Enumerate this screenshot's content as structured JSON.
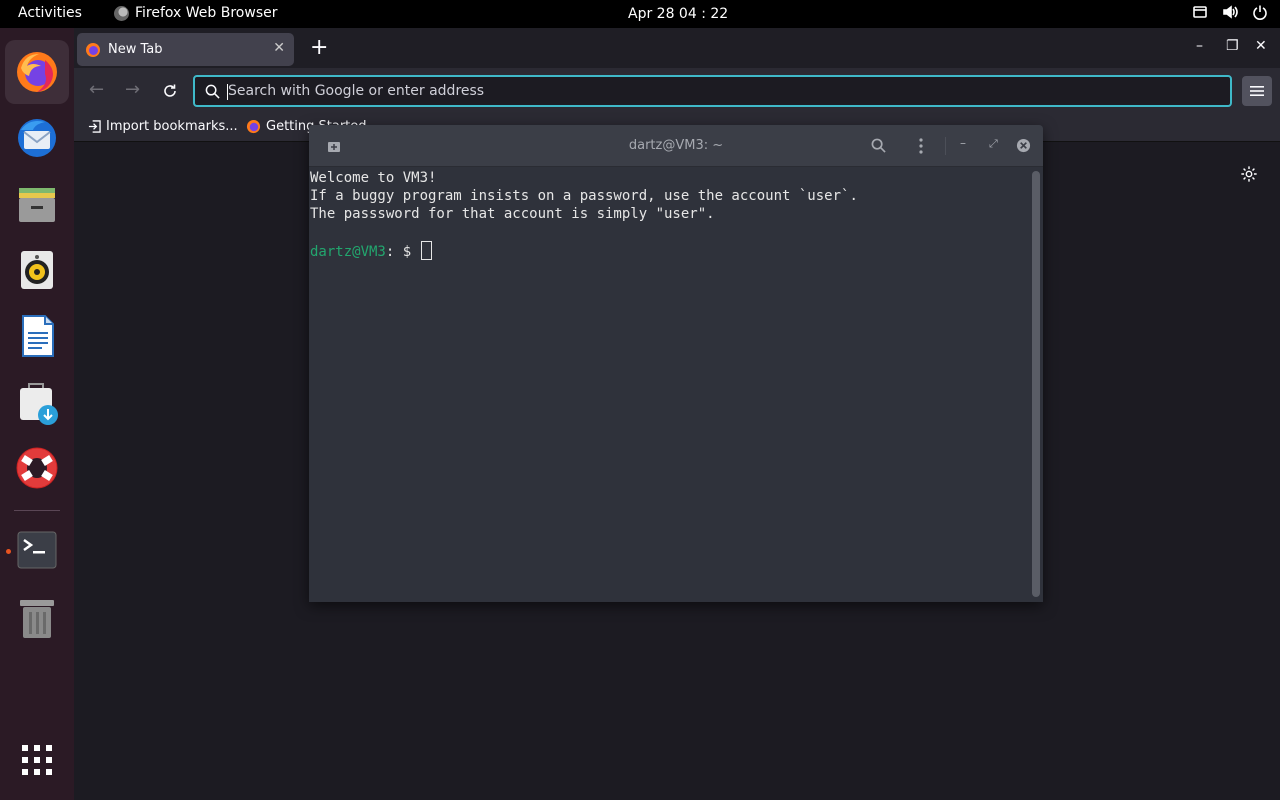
{
  "topbar": {
    "activities": "Activities",
    "app_name": "Firefox Web Browser",
    "clock": "Apr 28  04 : 22"
  },
  "dock": {
    "items": [
      "firefox-icon",
      "thunderbird-icon",
      "files-icon",
      "rhythmbox-icon",
      "writer-icon",
      "software-center-icon",
      "help-icon",
      "terminal-icon",
      "trash-icon",
      "show-apps-icon"
    ]
  },
  "browser": {
    "tab_title": "New Tab",
    "url_placeholder": "Search with Google or enter address",
    "bookmarks": [
      {
        "label": "Import bookmarks..."
      },
      {
        "label": "Getting Started"
      }
    ]
  },
  "terminal": {
    "title": "dartz@VM3: ~",
    "lines": [
      "Welcome to VM3!",
      "If a buggy program insists on a password, use the account `user`.",
      "The passsword for that account is simply \"user\"."
    ],
    "prompt_user": "dartz@VM3",
    "prompt_rest": ": $ "
  },
  "colors": {
    "accent_url": "#3fb9c9",
    "prompt_green": "#22a66e",
    "ubuntu_orange": "#e95420"
  }
}
